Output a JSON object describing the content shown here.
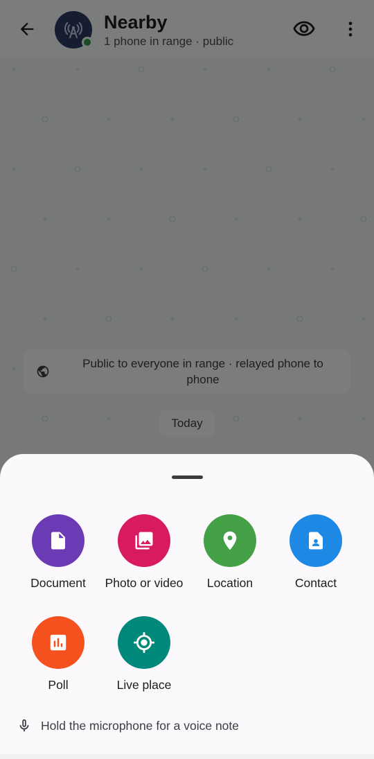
{
  "app_bar": {
    "title": "Nearby",
    "subtitle": "1 phone in range · public",
    "back_icon": "arrow-back-icon",
    "avatar_icon": "broadcast-tower-icon",
    "eye_icon": "eye-icon",
    "more_icon": "more-vert-icon"
  },
  "chat": {
    "notice_text": "Public to everyone in range · relayed phone to phone",
    "notice_icon": "globe-icon",
    "date_chip": "Today"
  },
  "attach_sheet": {
    "options": [
      {
        "label": "Document",
        "icon": "document-icon",
        "color": "#6a3bb5"
      },
      {
        "label": "Photo or video",
        "icon": "photo-library-icon",
        "color": "#d81b60"
      },
      {
        "label": "Location",
        "icon": "location-pin-icon",
        "color": "#43a047"
      },
      {
        "label": "Contact",
        "icon": "contact-card-icon",
        "color": "#1e88e5"
      },
      {
        "label": "Poll",
        "icon": "poll-icon",
        "color": "#f4511e"
      },
      {
        "label": "Live place",
        "icon": "live-location-icon",
        "color": "#00897b"
      }
    ],
    "voice_hint": "Hold the microphone for a voice note",
    "voice_icon": "microphone-icon"
  },
  "colors": {
    "online": "#2e9b4a",
    "avatar_bg": "#2f3a63"
  }
}
